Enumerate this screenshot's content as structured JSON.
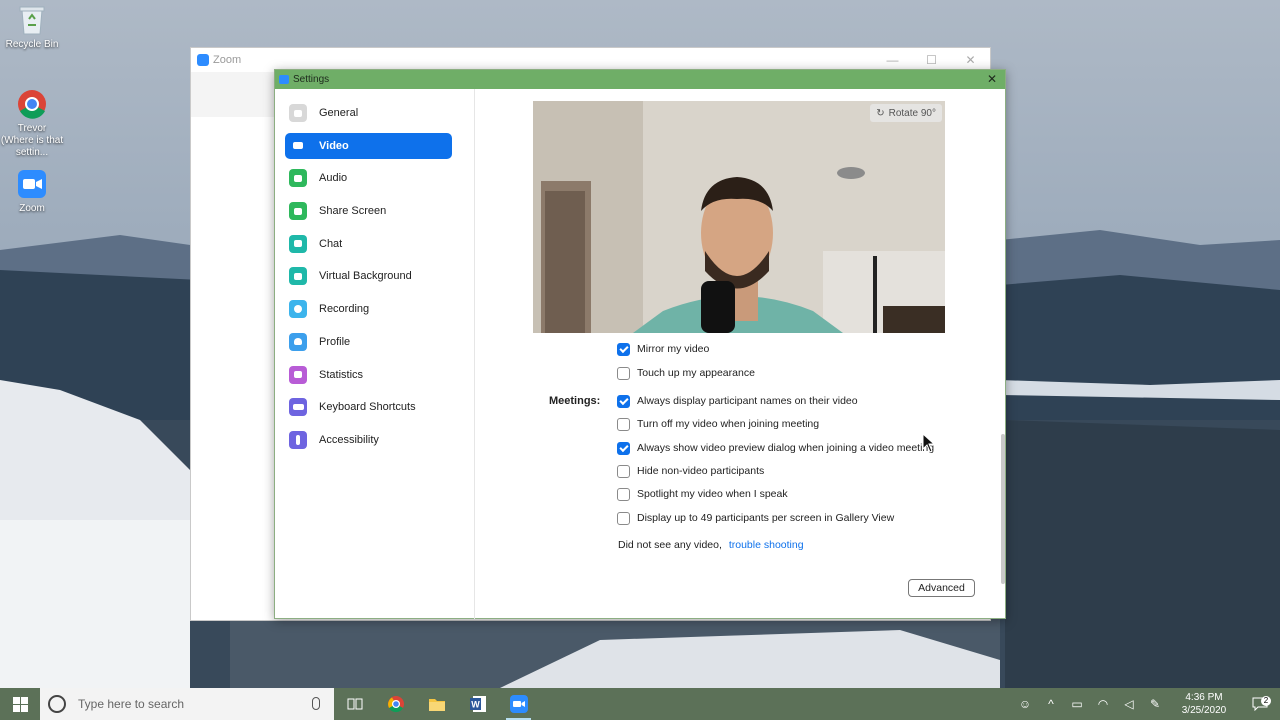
{
  "desktop": {
    "icons": [
      {
        "label": "Recycle Bin"
      },
      {
        "label": "Trevor (Where is that settin..."
      },
      {
        "label": "Zoom"
      }
    ]
  },
  "zoom_window": {
    "title": "Zoom",
    "controls": {
      "minimize": "—",
      "maximize": "☐",
      "close": "✕"
    }
  },
  "settings": {
    "title": "Settings",
    "close": "✕",
    "nav": [
      {
        "label": "General",
        "icon": "gear-icon",
        "color": "#d8d8d8"
      },
      {
        "label": "Video",
        "icon": "video-camera-icon",
        "color": "#0e71eb",
        "active": true
      },
      {
        "label": "Audio",
        "icon": "headphones-icon",
        "color": "#2eb85c"
      },
      {
        "label": "Share Screen",
        "icon": "share-screen-icon",
        "color": "#2eb85c"
      },
      {
        "label": "Chat",
        "icon": "chat-bubble-icon",
        "color": "#1fb8a9"
      },
      {
        "label": "Virtual Background",
        "icon": "person-background-icon",
        "color": "#1fb8a9"
      },
      {
        "label": "Recording",
        "icon": "record-icon",
        "color": "#3cb4ec"
      },
      {
        "label": "Profile",
        "icon": "person-icon",
        "color": "#3c9fec"
      },
      {
        "label": "Statistics",
        "icon": "bar-chart-icon",
        "color": "#b85cd6"
      },
      {
        "label": "Keyboard Shortcuts",
        "icon": "keyboard-icon",
        "color": "#6e64e0"
      },
      {
        "label": "Accessibility",
        "icon": "accessibility-icon",
        "color": "#6e64e0"
      }
    ],
    "video": {
      "rotate_label": "Rotate 90°",
      "options_top": [
        {
          "label": "Mirror my video",
          "checked": true
        },
        {
          "label": "Touch up my appearance",
          "checked": false
        }
      ],
      "meetings_label": "Meetings:",
      "options_meetings": [
        {
          "label": "Always display participant names on their video",
          "checked": true
        },
        {
          "label": "Turn off my video when joining meeting",
          "checked": false
        },
        {
          "label": "Always show video preview dialog when joining a video meeting",
          "checked": true
        },
        {
          "label": "Hide non-video participants",
          "checked": false
        },
        {
          "label": "Spotlight my video when I speak",
          "checked": false
        },
        {
          "label": "Display up to 49 participants per screen in Gallery View",
          "checked": false
        }
      ],
      "trouble_text": "Did not see any video,",
      "trouble_link": "trouble shooting",
      "advanced_label": "Advanced"
    }
  },
  "taskbar": {
    "search_placeholder": "Type here to search",
    "apps": [
      "task-view-icon",
      "chrome-icon",
      "file-explorer-icon",
      "word-icon",
      "zoom-icon"
    ],
    "time": "4:36 PM",
    "date": "3/25/2020",
    "notification_count": "2"
  }
}
